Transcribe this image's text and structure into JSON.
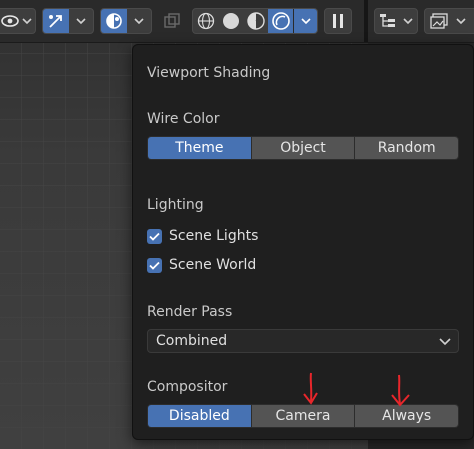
{
  "popup": {
    "title": "Viewport Shading",
    "wire_color": {
      "label": "Wire Color",
      "options": [
        "Theme",
        "Object",
        "Random"
      ],
      "selected": "Theme"
    },
    "lighting": {
      "label": "Lighting",
      "checks": [
        {
          "label": "Scene Lights",
          "checked": true
        },
        {
          "label": "Scene World",
          "checked": true
        }
      ]
    },
    "render_pass": {
      "label": "Render Pass",
      "value": "Combined"
    },
    "compositor": {
      "label": "Compositor",
      "options": [
        "Disabled",
        "Camera",
        "Always"
      ],
      "selected": "Disabled"
    }
  },
  "annotation": {
    "color": "#e8262b"
  },
  "colors": {
    "accent": "#4772b3",
    "popup_bg": "#1f1f1f",
    "button_bg": "#545454"
  }
}
